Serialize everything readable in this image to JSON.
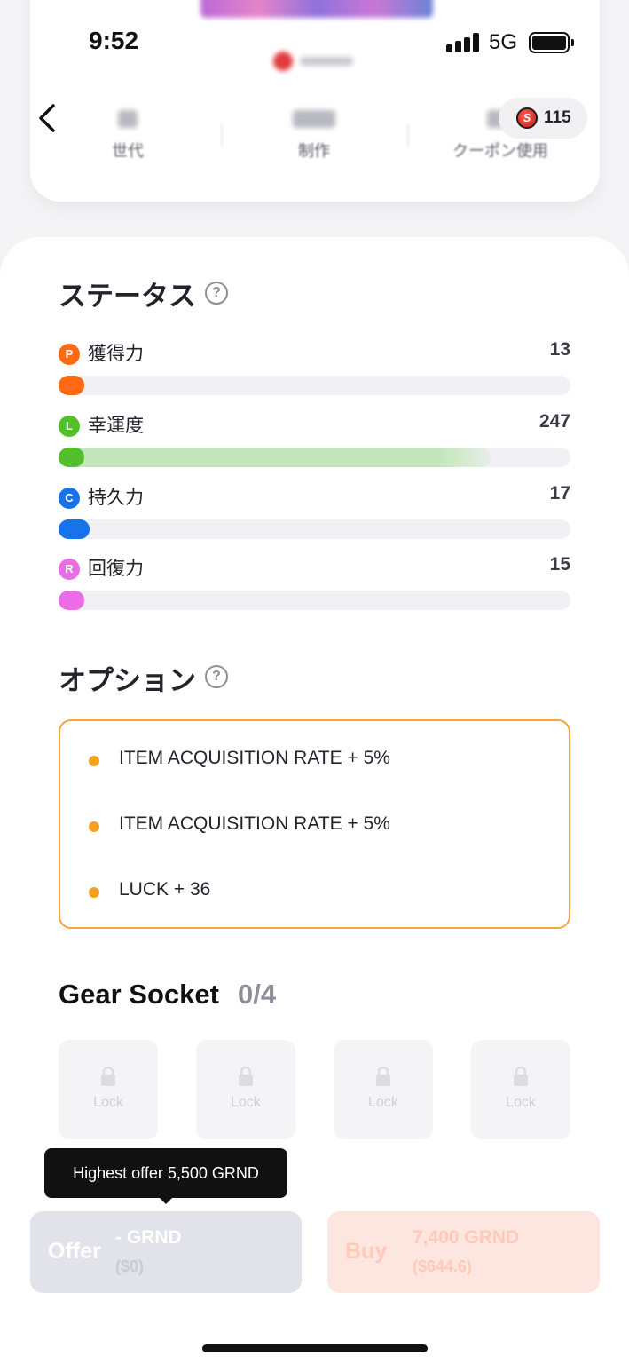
{
  "status_bar": {
    "time": "9:52",
    "network": "5G"
  },
  "header": {
    "back_icon": "chevron-left-icon",
    "coin_symbol": "S",
    "coin_balance": "115",
    "stats": [
      {
        "label": "世代"
      },
      {
        "label": "制作"
      },
      {
        "label": "クーポン使用"
      }
    ]
  },
  "status_section": {
    "title": "ステータス",
    "help": "?",
    "items": [
      {
        "badge": "P",
        "name": "獲得力",
        "value": "13",
        "color": "#ff6a13",
        "fill": 0.05,
        "ext_fill": 0.05
      },
      {
        "badge": "L",
        "name": "幸運度",
        "value": "247",
        "color": "#52c02b",
        "fill": 0.05,
        "ext_fill": 0.845,
        "ext_color": "#c3e6bb"
      },
      {
        "badge": "C",
        "name": "持久力",
        "value": "17",
        "color": "#1673ea",
        "fill": 0.06,
        "ext_fill": 0.06
      },
      {
        "badge": "R",
        "name": "回復力",
        "value": "15",
        "color": "#ea6ce6",
        "fill": 0.05,
        "ext_fill": 0.05
      }
    ]
  },
  "options_section": {
    "title": "オプション",
    "help": "?",
    "items": [
      "ITEM ACQUISITION RATE + 5%",
      "ITEM ACQUISITION RATE + 5%",
      "LUCK + 36"
    ]
  },
  "gear_socket": {
    "title": "Gear Socket",
    "count": "0/4",
    "slots": [
      "Lock",
      "Lock",
      "Lock",
      "Lock"
    ]
  },
  "tooltip": {
    "text": "Highest offer 5,500 GRND"
  },
  "actions": {
    "offer": {
      "label": "Offer",
      "price": "- GRND",
      "usd": "($0)"
    },
    "buy": {
      "label": "Buy",
      "price": "7,400 GRND",
      "usd": "($644.6)"
    }
  },
  "colors": {
    "accent_orange": "#f5a53a",
    "buy_bg": "#fde6df",
    "offer_bg": "#e2e2ea"
  }
}
